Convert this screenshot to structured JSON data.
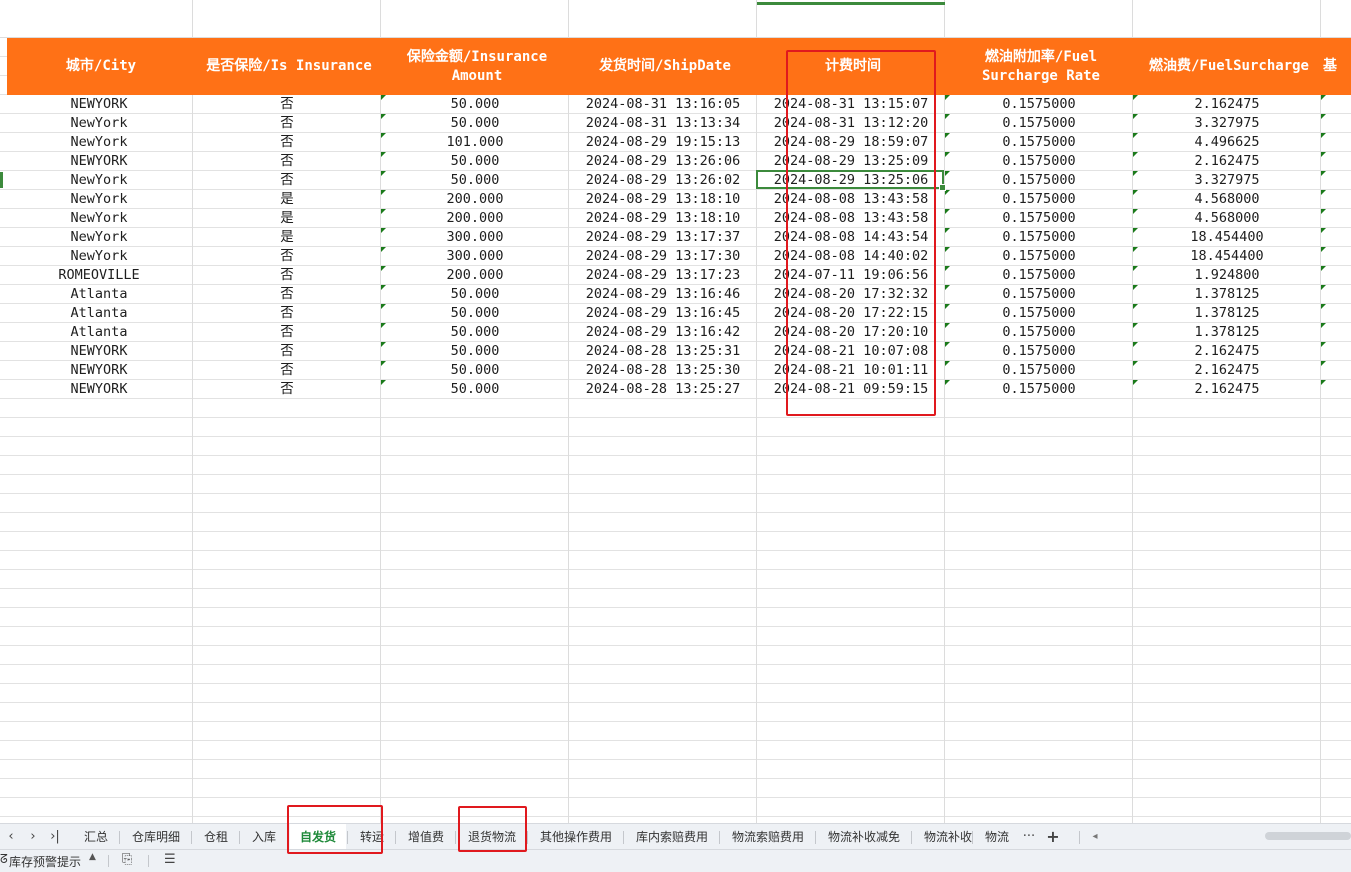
{
  "headers": [
    "城市/City",
    "是否保险/Is Insurance",
    "保险金额/Insurance Amount",
    "发货时间/ShipDate",
    "计费时间",
    "燃油附加率/Fuel Surcharge Rate",
    "燃油费/FuelSurcharge",
    "基"
  ],
  "rows": [
    [
      "NEWYORK",
      "否",
      "50.000",
      "2024-08-31 13:16:05",
      "2024-08-31 13:15:07",
      "0.1575000",
      "2.162475"
    ],
    [
      "NewYork",
      "否",
      "50.000",
      "2024-08-31 13:13:34",
      "2024-08-31 13:12:20",
      "0.1575000",
      "3.327975"
    ],
    [
      "NewYork",
      "否",
      "101.000",
      "2024-08-29 19:15:13",
      "2024-08-29 18:59:07",
      "0.1575000",
      "4.496625"
    ],
    [
      "NEWYORK",
      "否",
      "50.000",
      "2024-08-29 13:26:06",
      "2024-08-29 13:25:09",
      "0.1575000",
      "2.162475"
    ],
    [
      "NewYork",
      "否",
      "50.000",
      "2024-08-29 13:26:02",
      "2024-08-29 13:25:06",
      "0.1575000",
      "3.327975"
    ],
    [
      "NewYork",
      "是",
      "200.000",
      "2024-08-29 13:18:10",
      "2024-08-08 13:43:58",
      "0.1575000",
      "4.568000"
    ],
    [
      "NewYork",
      "是",
      "200.000",
      "2024-08-29 13:18:10",
      "2024-08-08 13:43:58",
      "0.1575000",
      "4.568000"
    ],
    [
      "NewYork",
      "是",
      "300.000",
      "2024-08-29 13:17:37",
      "2024-08-08 14:43:54",
      "0.1575000",
      "18.454400"
    ],
    [
      "NewYork",
      "否",
      "300.000",
      "2024-08-29 13:17:30",
      "2024-08-08 14:40:02",
      "0.1575000",
      "18.454400"
    ],
    [
      "ROMEOVILLE",
      "否",
      "200.000",
      "2024-08-29 13:17:23",
      "2024-07-11 19:06:56",
      "0.1575000",
      "1.924800"
    ],
    [
      "Atlanta",
      "否",
      "50.000",
      "2024-08-29 13:16:46",
      "2024-08-20 17:32:32",
      "0.1575000",
      "1.378125"
    ],
    [
      "Atlanta",
      "否",
      "50.000",
      "2024-08-29 13:16:45",
      "2024-08-20 17:22:15",
      "0.1575000",
      "1.378125"
    ],
    [
      "Atlanta",
      "否",
      "50.000",
      "2024-08-29 13:16:42",
      "2024-08-20 17:20:10",
      "0.1575000",
      "1.378125"
    ],
    [
      "NEWYORK",
      "否",
      "50.000",
      "2024-08-28 13:25:31",
      "2024-08-21 10:07:08",
      "0.1575000",
      "2.162475"
    ],
    [
      "NEWYORK",
      "否",
      "50.000",
      "2024-08-28 13:25:30",
      "2024-08-21 10:01:11",
      "0.1575000",
      "2.162475"
    ],
    [
      "NEWYORK",
      "否",
      "50.000",
      "2024-08-28 13:25:27",
      "2024-08-21 09:59:15",
      "0.1575000",
      "2.162475"
    ]
  ],
  "tabs": [
    "汇总",
    "仓库明细",
    "仓租",
    "入库",
    "自发货",
    "转运",
    "增值费",
    "退货物流",
    "其他操作费用",
    "库内索赔费用",
    "物流索赔费用",
    "物流补收减免",
    "物流补收",
    "物流"
  ],
  "active_tab": "自发货",
  "nav": {
    "prev": "‹",
    "next": "›",
    "last": "›|",
    "more": "···",
    "add": "+",
    "scroll_left": "◂"
  },
  "status": {
    "warning_label": "库存预警提示"
  },
  "colors": {
    "header_bg": "#ff7116",
    "accent_green": "#3c8a3c",
    "annotation_red": "#e0191e"
  }
}
